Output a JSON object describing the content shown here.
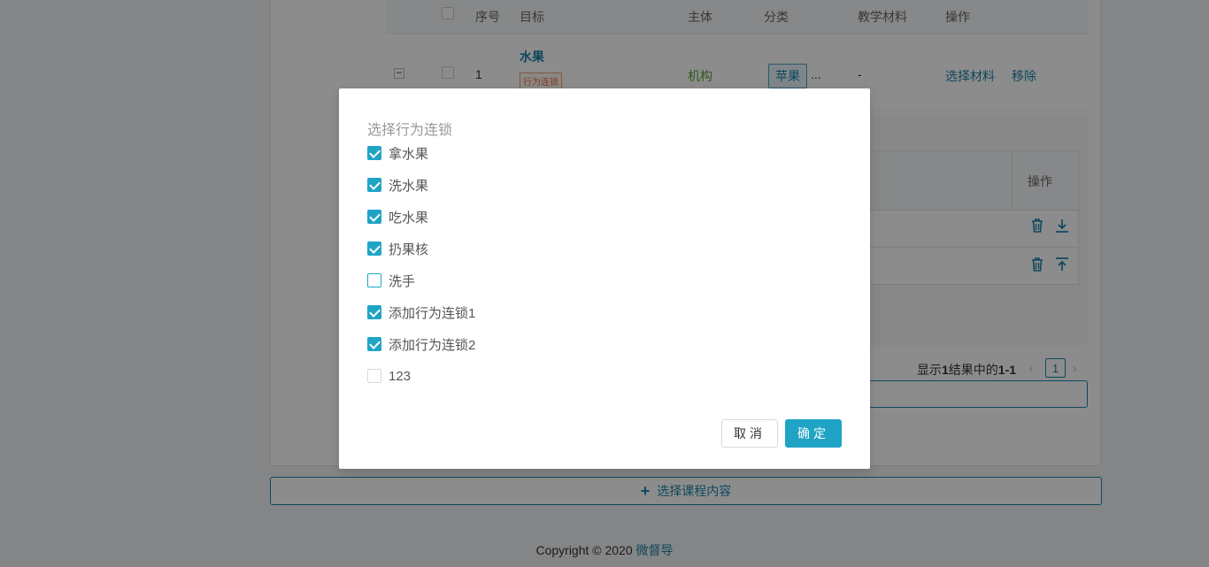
{
  "table": {
    "headers": {
      "seq": "序号",
      "goal": "目标",
      "subject": "主体",
      "category": "分类",
      "material": "教学材料",
      "actions": "操作"
    },
    "row": {
      "expand": "–",
      "seq": "1",
      "goal_name": "水果",
      "goal_tag": "行为连锁",
      "subject": "机构",
      "category_tag": "苹果",
      "category_more": "...",
      "material": "-",
      "action_select": "选择材料",
      "action_remove": "移除"
    }
  },
  "subtable": {
    "actions_header": "操作"
  },
  "pagination": {
    "summary_prefix": "显示",
    "summary_total": "1",
    "summary_mid": "结果中的",
    "summary_range": "1-1",
    "current_page": "1"
  },
  "add_content": {
    "label": "选择课程内容"
  },
  "footer": {
    "copyright": "Copyright © 2020",
    "brand": "微督导"
  },
  "modal": {
    "title": "选择行为连锁",
    "options": [
      {
        "label": "拿水果",
        "checked": true
      },
      {
        "label": "洗水果",
        "checked": true
      },
      {
        "label": "吃水果",
        "checked": true
      },
      {
        "label": "扔果核",
        "checked": true
      },
      {
        "label": "洗手",
        "checked": false
      },
      {
        "label": "添加行为连锁1",
        "checked": true
      },
      {
        "label": "添加行为连锁2",
        "checked": true
      },
      {
        "label": "123",
        "checked": false
      }
    ],
    "cancel": "取消",
    "confirm": "确定"
  },
  "colors": {
    "accent": "#1fa4c6",
    "link": "#1a84a8",
    "tag_orange": "#e8743b",
    "subject_green": "#5aa33a"
  }
}
